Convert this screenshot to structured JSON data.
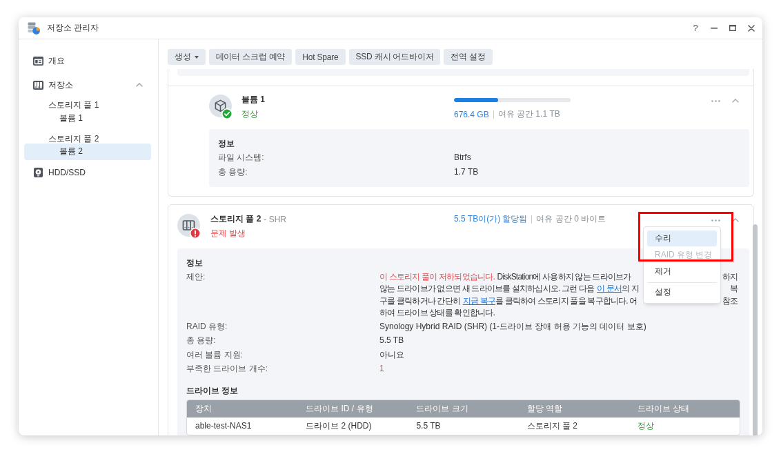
{
  "window": {
    "title": "저장소 관리자",
    "controls": [
      {
        "kind": "help",
        "label": "?"
      },
      {
        "kind": "minimize"
      },
      {
        "kind": "maximize"
      },
      {
        "kind": "close"
      }
    ]
  },
  "sidebar": {
    "items": [
      {
        "label": "개요",
        "kind": "overview",
        "selected": false
      },
      {
        "label": "저장소",
        "kind": "storage",
        "selected": false,
        "expanded": true,
        "children": [
          {
            "label": "스토리지 풀 1",
            "selected": false,
            "children": [
              {
                "label": "볼륨 1",
                "selected": false
              }
            ]
          },
          {
            "label": "스토리지 풀 2",
            "selected": false,
            "children": [
              {
                "label": "볼륨 2",
                "selected": true
              }
            ]
          }
        ]
      },
      {
        "label": "HDD/SSD",
        "kind": "drive",
        "selected": false
      }
    ]
  },
  "toolbar": {
    "buttons": [
      {
        "label": "생성",
        "dropdown": true
      },
      {
        "label": "데이터 스크럽 예약",
        "dropdown": false
      },
      {
        "label": "Hot Spare",
        "dropdown": false
      },
      {
        "label": "SSD 캐시 어드바이저",
        "dropdown": false
      },
      {
        "label": "전역 설정",
        "dropdown": false
      }
    ]
  },
  "pools": [
    {
      "volumes": [
        {
          "name": "볼륨 1",
          "status": {
            "label": "정상",
            "kind": "ok"
          },
          "level": 0.38,
          "usage": {
            "used": "676.4 GB",
            "free": "여유 공간 1.1 TB"
          },
          "expanded": true,
          "info": {
            "title": "정보",
            "rows": [
              {
                "kind": "text",
                "label": "파일 시스템:",
                "value": "Btrfs"
              },
              {
                "kind": "text",
                "label": "총 용량:",
                "value": "1.7 TB"
              }
            ]
          }
        }
      ]
    },
    {
      "name": "스토리지 풀 2",
      "raid": "- SHR",
      "status": {
        "label": "문제 발생",
        "kind": "error"
      },
      "usage": {
        "used": "5.5 TB이(가) 할당됨",
        "free": "여유 공간 0 바이트"
      },
      "expanded": true,
      "info": {
        "title": "정보",
        "rows": [
          {
            "kind": "suggestion",
            "label": "제안:",
            "lines": [
              {
                "segments": [
                  {
                    "kind": "warning",
                    "text": "이 스토리지 풀이 저하되었습니다.",
                    "spaced": false
                  },
                  {
                    "kind": "text",
                    "text": "DiskStation에 사용하지 않는 드라이브가",
                    "spaced": true
                  }
                ],
                "tail": "하지"
              },
              {
                "segments": [
                  {
                    "kind": "text",
                    "text": "않는 드라이브가 없으면 새 드라이브를 설치하십시오. 그런 다음",
                    "spaced": false
                  },
                  {
                    "kind": "link",
                    "text": "이 문서",
                    "spaced": true
                  },
                  {
                    "kind": "text",
                    "text": "의 지",
                    "spaced": false
                  }
                ],
                "tail": "복"
              },
              {
                "segments": [
                  {
                    "kind": "text",
                    "text": "구를 클릭하거나 간단히",
                    "spaced": false
                  },
                  {
                    "kind": "link",
                    "text": "지금 복구",
                    "spaced": true
                  },
                  {
                    "kind": "text",
                    "text": "를 클릭하여 스토리지 풀을 복구합니다. 어",
                    "spaced": false
                  }
                ],
                "tail": "참조"
              },
              {
                "segments": [
                  {
                    "kind": "text",
                    "text": "하여 드라이브 상태를 확인합니다.",
                    "spaced": false
                  }
                ]
              }
            ]
          },
          {
            "kind": "text",
            "label": "RAID 유형:",
            "value": "Synology Hybrid RAID (SHR) (1-드라이브 장애 허용 기능의 데이터 보호)"
          },
          {
            "kind": "text",
            "label": "총 용량:",
            "value": "5.5 TB"
          },
          {
            "kind": "text",
            "label": "여러 볼륨 지원:",
            "value": "아니요"
          },
          {
            "kind": "alert",
            "label": "부족한 드라이브 개수:",
            "value": "1"
          }
        ],
        "drives": {
          "title": "드라이브 정보",
          "columns": [
            "장치",
            "드라이브 ID / 유형",
            "드라이브 크기",
            "할당 역할",
            "드라이브 상태"
          ],
          "rows": [
            {
              "kind": "ok",
              "cells": [
                "able-test-NAS1",
                "드라이브 2 (HDD)",
                "5.5 TB",
                "스토리지 풀 2",
                "정상"
              ]
            }
          ]
        }
      },
      "menu": {
        "annotation": {
          "kind": "frame"
        },
        "groups": [
          {
            "items": [
              {
                "label": "수리",
                "selected": true,
                "disabled": false
              },
              {
                "label": "RAID 유형 변경",
                "selected": false,
                "disabled": true
              },
              {
                "label": "제거",
                "selected": false,
                "disabled": false
              }
            ]
          },
          {
            "items": [
              {
                "label": "설정",
                "selected": false,
                "disabled": false
              }
            ]
          }
        ]
      }
    }
  ]
}
